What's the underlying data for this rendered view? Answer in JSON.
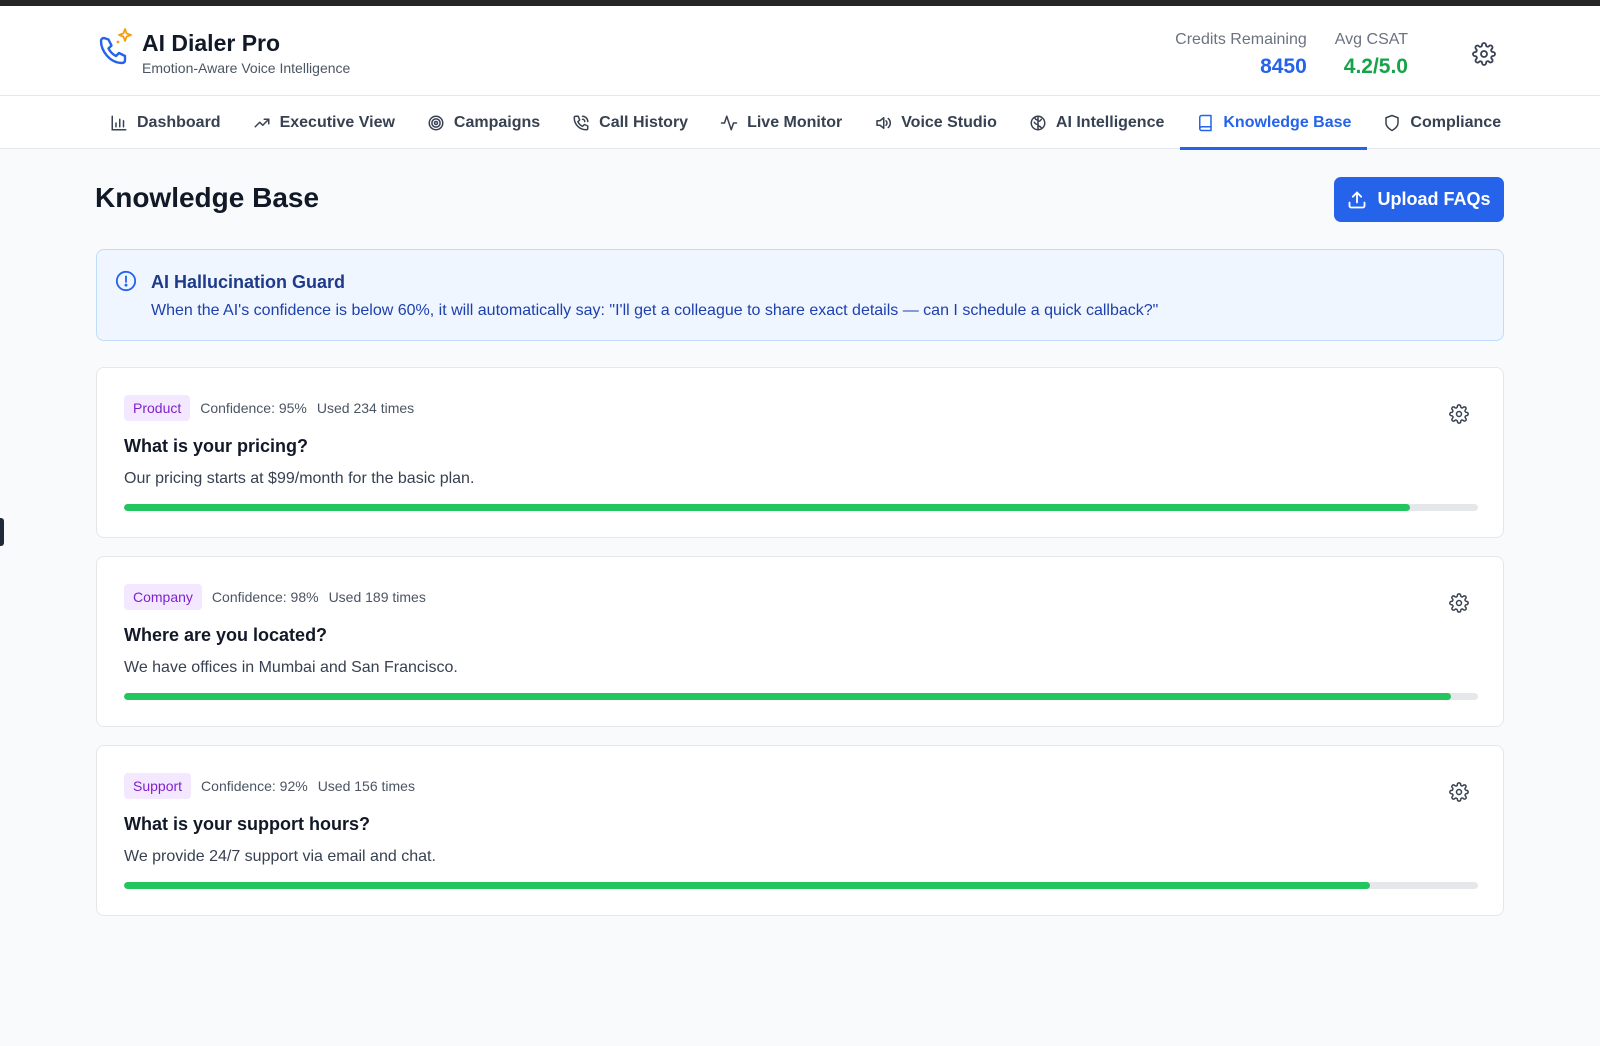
{
  "app": {
    "title": "AI Dialer Pro",
    "subtitle": "Emotion-Aware Voice Intelligence"
  },
  "stats": {
    "credits_label": "Credits Remaining",
    "credits_value": "8450",
    "csat_label": "Avg CSAT",
    "csat_value": "4.2/5.0"
  },
  "nav": {
    "tabs": [
      {
        "label": "Dashboard",
        "icon": "bar-chart-icon"
      },
      {
        "label": "Executive View",
        "icon": "trending-up-icon"
      },
      {
        "label": "Campaigns",
        "icon": "target-icon"
      },
      {
        "label": "Call History",
        "icon": "phone-call-icon"
      },
      {
        "label": "Live Monitor",
        "icon": "activity-icon"
      },
      {
        "label": "Voice Studio",
        "icon": "speaker-icon"
      },
      {
        "label": "AI Intelligence",
        "icon": "brain-icon"
      },
      {
        "label": "Knowledge Base",
        "icon": "book-icon",
        "active": true
      },
      {
        "label": "Compliance",
        "icon": "shield-icon"
      }
    ]
  },
  "page": {
    "title": "Knowledge Base",
    "upload_label": "Upload FAQs"
  },
  "guard": {
    "title": "AI Hallucination Guard",
    "text": "When the AI's confidence is below 60%, it will automatically say: \"I'll get a colleague to share exact details — can I schedule a quick callback?\""
  },
  "faqs": [
    {
      "category": "Product",
      "confidence": "Confidence: 95%",
      "used": "Used 234 times",
      "question": "What is your pricing?",
      "answer": "Our pricing starts at $99/month for the basic plan.",
      "confidence_value": 0.95
    },
    {
      "category": "Company",
      "confidence": "Confidence: 98%",
      "used": "Used 189 times",
      "question": "Where are you located?",
      "answer": "We have offices in Mumbai and San Francisco.",
      "confidence_value": 0.98
    },
    {
      "category": "Support",
      "confidence": "Confidence: 92%",
      "used": "Used 156 times",
      "question": "What is your support hours?",
      "answer": "We provide 24/7 support via email and chat.",
      "confidence_value": 0.92
    }
  ],
  "colors": {
    "accent": "#2563eb",
    "success": "#16a34a",
    "progress": "#22c55e",
    "tag_bg": "#f3e8ff",
    "tag_text": "#7e22ce"
  }
}
